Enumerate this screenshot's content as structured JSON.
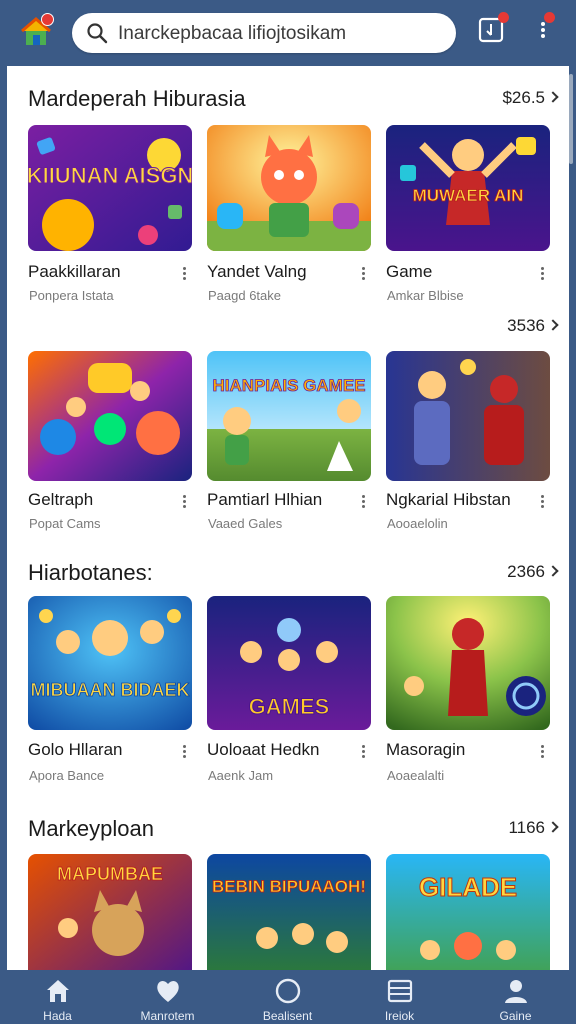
{
  "search": {
    "placeholder": "Inarckepbacaa lifiojtosikam"
  },
  "sections": [
    {
      "title": "Mardeperah Hiburasia",
      "more": "$26.5",
      "cards": [
        {
          "title": "Paakkillaran",
          "sub": "Ponpera Istata",
          "thumb": "game-art-monsters"
        },
        {
          "title": "Yandet Valng",
          "sub": "Paagd 6take",
          "thumb": "game-art-fox"
        },
        {
          "title": "Game",
          "sub": "Amkar Blbise",
          "thumb": "game-art-hero"
        }
      ]
    },
    {
      "title": "",
      "more": "3536",
      "cards": [
        {
          "title": "Geltraph",
          "sub": "Popat Cams",
          "thumb": "game-art-puzzle"
        },
        {
          "title": "Pamtiarl Hlhian",
          "sub": "Vaaed Gales",
          "thumb": "game-art-meadow"
        },
        {
          "title": "Ngkarial Hibstan",
          "sub": "Aooaelolin",
          "thumb": "game-art-robots"
        }
      ]
    },
    {
      "title": "Hiarbotanes:",
      "more": "2366",
      "cards": [
        {
          "title": "Golo Hllaran",
          "sub": "Apora Bance",
          "thumb": "game-art-party"
        },
        {
          "title": "Uoloaat Hedkn",
          "sub": "Aaenk Jam",
          "thumb": "game-art-crowd"
        },
        {
          "title": "Masoragin",
          "sub": "Aoaealalti",
          "thumb": "game-art-battle"
        }
      ]
    },
    {
      "title": "Markeyploan",
      "more": "1166",
      "cards": [
        {
          "title": "",
          "sub": "",
          "thumb": "game-art-dog"
        },
        {
          "title": "",
          "sub": "",
          "thumb": "game-art-team"
        },
        {
          "title": "",
          "sub": "",
          "thumb": "game-art-arcade"
        }
      ]
    }
  ],
  "thumb_text": {
    "c00": "KIIUNAN AISGN",
    "c11": "HIANPIAIS GAMEE",
    "c02": "MUWAER AIN",
    "c20": "MIBUAAN BIDAEK",
    "c21": "GAMES",
    "c30": "MAPUMBAE",
    "c31": "BEBIN BIPUAAOH!",
    "c32": "GILADE"
  },
  "nav": [
    {
      "label": "Hada",
      "icon": "home-icon"
    },
    {
      "label": "Manrotem",
      "icon": "heart-icon"
    },
    {
      "label": "Bealisent",
      "icon": "circle-icon"
    },
    {
      "label": "Ireiok",
      "icon": "list-icon"
    },
    {
      "label": "Gaine",
      "icon": "profile-icon"
    }
  ],
  "colors": {
    "bar": "#3b5a86",
    "badge": "#e53935"
  }
}
